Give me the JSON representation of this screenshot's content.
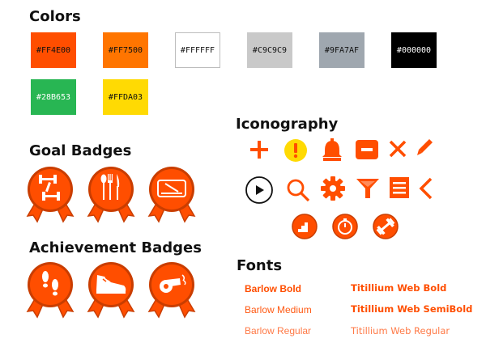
{
  "headings": {
    "colors": "Colors",
    "goal_badges": "Goal Badges",
    "achievement_badges": "Achievement Badges",
    "iconography": "Iconography",
    "fonts": "Fonts"
  },
  "colors": [
    {
      "hex": "#FF4E00"
    },
    {
      "hex": "#FF7500"
    },
    {
      "hex": "#FFFFFF"
    },
    {
      "hex": "#C9C9C9"
    },
    {
      "hex": "#9FA7AF"
    },
    {
      "hex": "#000000"
    },
    {
      "hex": "#28B653"
    },
    {
      "hex": "#FFDA03"
    }
  ],
  "goal_badges": [
    "dumbbells-icon",
    "fork-knife-spoon-icon",
    "weighing-scale-icon"
  ],
  "achievement_badges": [
    "footprints-icon",
    "sneaker-icon",
    "whistle-icon"
  ],
  "icons": [
    "plus-icon",
    "exclamation-icon",
    "bell-icon",
    "minus-icon",
    "close-icon",
    "pencil-icon",
    "play-icon",
    "search-icon",
    "gear-icon",
    "filter-icon",
    "list-icon",
    "chevron-left-icon",
    "stairs-icon",
    "stopwatch-icon",
    "dumbbell-icon"
  ],
  "fonts": {
    "barlow_bold": "Barlow Bold",
    "barlow_medium": "Barlow Medium",
    "barlow_regular": "Barlow Regular",
    "titillium_bold": "Titillium Web Bold",
    "titillium_semibold": "Titillium Web SemiBold",
    "titillium_regular": "Titillium Web Regular"
  },
  "accent_color": "#FF4E00"
}
